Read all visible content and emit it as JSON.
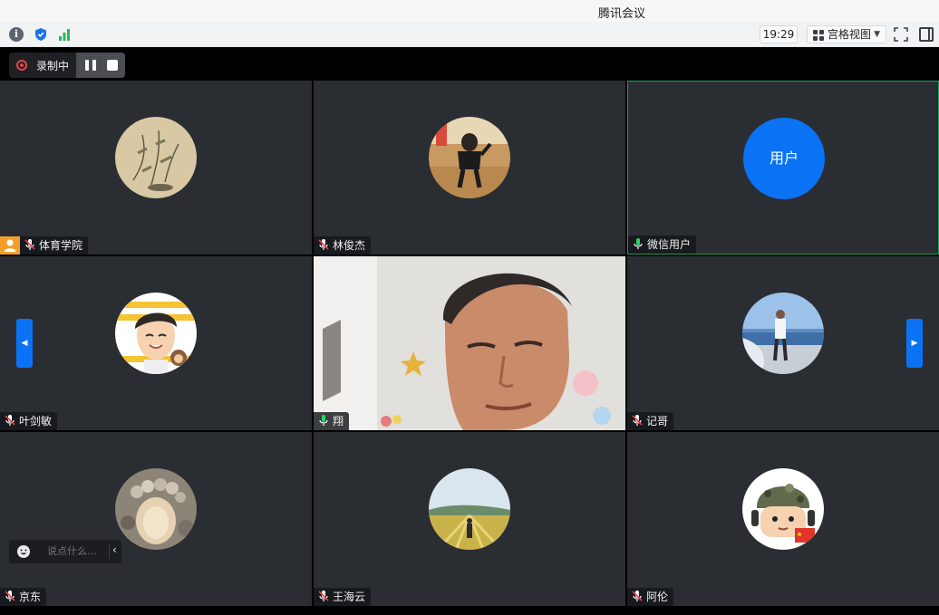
{
  "window": {
    "title": "腾讯会议"
  },
  "toolbar": {
    "icons": [
      "info-icon",
      "shield-icon",
      "signal-icon",
      "fullscreen-icon",
      "side-panel-icon"
    ],
    "time": "19:29",
    "view_label": "宫格视图"
  },
  "recording": {
    "label": "录制中",
    "indicator_color": "#e84343"
  },
  "colors": {
    "accent": "#0a73f5",
    "active_speaker": "#19a05b",
    "host_badge": "#f59f2b",
    "tile_bg": "#2a2d32"
  },
  "participants": [
    {
      "name": "体育学院",
      "avatar": "ink-painting",
      "mic": "muted",
      "host": true
    },
    {
      "name": "林俊杰",
      "avatar": "photo-child",
      "mic": "muted"
    },
    {
      "name": "微信用户",
      "avatar": "text",
      "avatar_text": "用户",
      "mic": "on",
      "active": true
    },
    {
      "name": "叶剑敏",
      "avatar": "cartoon",
      "mic": "muted"
    },
    {
      "name": "翔",
      "avatar": "video",
      "mic": "on"
    },
    {
      "name": "记哥",
      "avatar": "photo-sea",
      "mic": "muted"
    },
    {
      "name": "京东",
      "avatar": "photo-stones",
      "mic": "muted"
    },
    {
      "name": "王海云",
      "avatar": "photo-field",
      "mic": "muted"
    },
    {
      "name": "阿伦",
      "avatar": "cartoon-soldier",
      "mic": "muted"
    }
  ],
  "chat": {
    "placeholder": "说点什么..."
  }
}
